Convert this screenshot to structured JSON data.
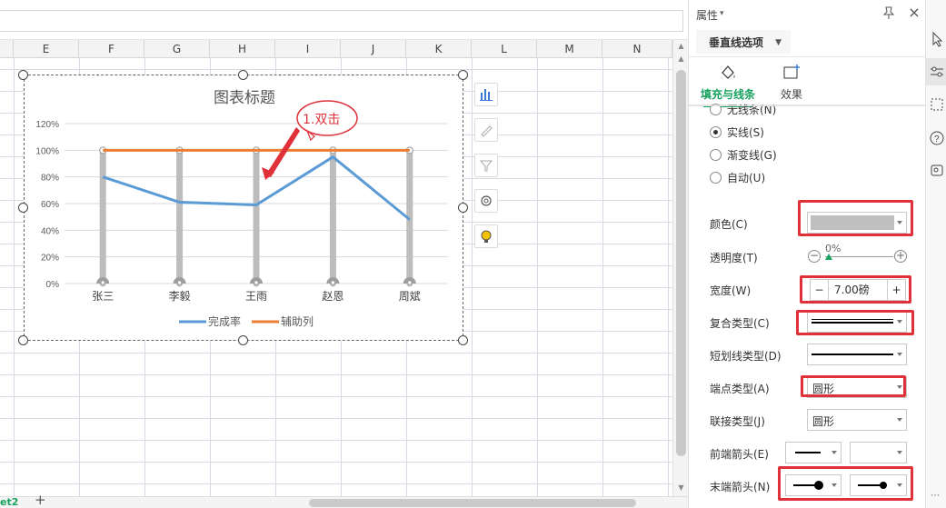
{
  "columns": [
    "E",
    "F",
    "G",
    "H",
    "I",
    "J",
    "K",
    "L",
    "M",
    "N"
  ],
  "sheet_tab": "et2",
  "add_sheet": "+",
  "chart_data": {
    "type": "line",
    "title": "图表标题",
    "categories": [
      "张三",
      "李毅",
      "王雨",
      "赵恩",
      "周斌"
    ],
    "ylim": [
      0,
      1.2
    ],
    "y_ticks": [
      "0%",
      "20%",
      "40%",
      "60%",
      "80%",
      "100%",
      "120%"
    ],
    "series": [
      {
        "name": "完成率",
        "values": [
          0.8,
          0.61,
          0.59,
          0.95,
          0.48
        ],
        "color": "#5b9bd5"
      },
      {
        "name": "辅助列",
        "values": [
          1.0,
          1.0,
          1.0,
          1.0,
          1.0
        ],
        "color": "#ed7d31"
      }
    ],
    "drop_lines_color": "#bdbdbd",
    "legend_position": "bottom",
    "grid": true
  },
  "annotation": {
    "text": "1.双击",
    "color": "#e0303a"
  },
  "panel": {
    "title": "属性",
    "dropdown": "垂直线选项",
    "tabs": [
      {
        "label": "填充与线条",
        "active": true
      },
      {
        "label": "效果",
        "active": false
      }
    ],
    "radios": [
      {
        "label": "无线条(N)",
        "checked": false
      },
      {
        "label": "实线(S)",
        "checked": true
      },
      {
        "label": "渐变线(G)",
        "checked": false
      },
      {
        "label": "自动(U)",
        "checked": false
      }
    ],
    "color_label": "颜色(C)",
    "color_value": "#bfbfbf",
    "transparency_label": "透明度(T)",
    "transparency_value": "0%",
    "width_label": "宽度(W)",
    "width_minus": "−",
    "width_value": "7.00磅",
    "width_plus": "+",
    "compound_label": "复合类型(C)",
    "dash_label": "短划线类型(D)",
    "cap_label": "端点类型(A)",
    "cap_value": "圆形",
    "join_label": "联接类型(J)",
    "join_value": "圆形",
    "begin_arrow_label": "前端箭头(E)",
    "end_arrow_label": "末端箭头(N)"
  }
}
